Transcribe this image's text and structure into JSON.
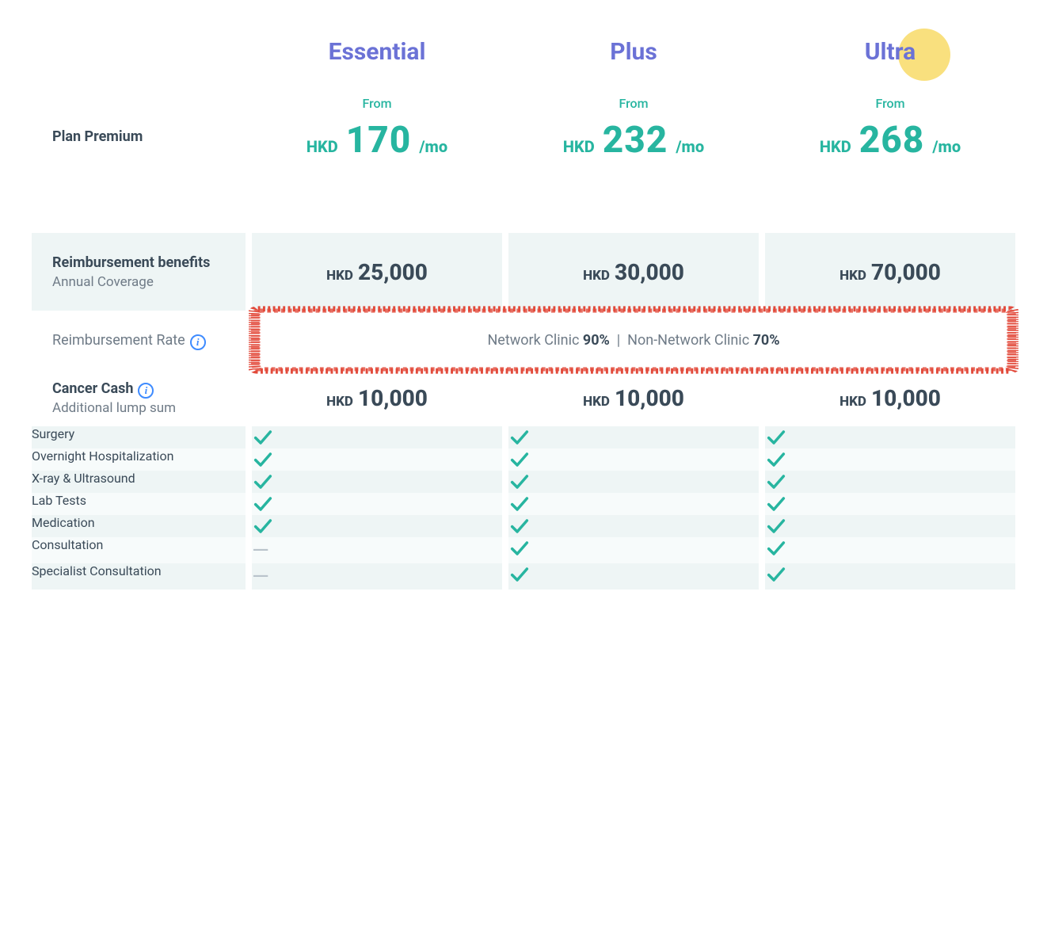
{
  "plans": [
    "Essential",
    "Plus",
    "Ultra"
  ],
  "premium": {
    "label": "Plan Premium",
    "from_text": "From",
    "currency": "HKD",
    "unit": "/mo",
    "values": [
      "170",
      "232",
      "268"
    ]
  },
  "coverage": {
    "title": "Reimbursement benefits",
    "subtitle": "Annual Coverage",
    "currency": "HKD",
    "values": [
      "25,000",
      "30,000",
      "70,000"
    ]
  },
  "rate": {
    "label": "Reimbursement Rate",
    "network_label": "Network Clinic",
    "network_value": "90%",
    "nonnetwork_label": "Non-Network Clinic",
    "nonnetwork_value": "70%"
  },
  "features": [
    {
      "label": "Surgery",
      "bg": true,
      "cells": [
        "check",
        "check",
        "check"
      ]
    },
    {
      "label": "Overnight Hospitalization",
      "bg": false,
      "cells": [
        "check",
        "check",
        "check"
      ]
    },
    {
      "label": "X-ray & Ultrasound",
      "bg": true,
      "cells": [
        "check",
        "check",
        "check"
      ]
    },
    {
      "label": "Lab Tests",
      "bg": false,
      "cells": [
        "check",
        "check",
        "check"
      ]
    },
    {
      "label": "Medication",
      "bg": true,
      "cells": [
        "check",
        "check",
        "check"
      ]
    },
    {
      "label": "Consultation",
      "bg": false,
      "cells": [
        "dash",
        "check",
        "check"
      ]
    },
    {
      "label": "Specialist Consultation",
      "bg": true,
      "cells": [
        "dash",
        "check",
        "check"
      ]
    }
  ],
  "cancer": {
    "title": "Cancer Cash",
    "subtitle": "Additional lump sum",
    "currency": "HKD",
    "values": [
      "10,000",
      "10,000",
      "10,000"
    ]
  }
}
